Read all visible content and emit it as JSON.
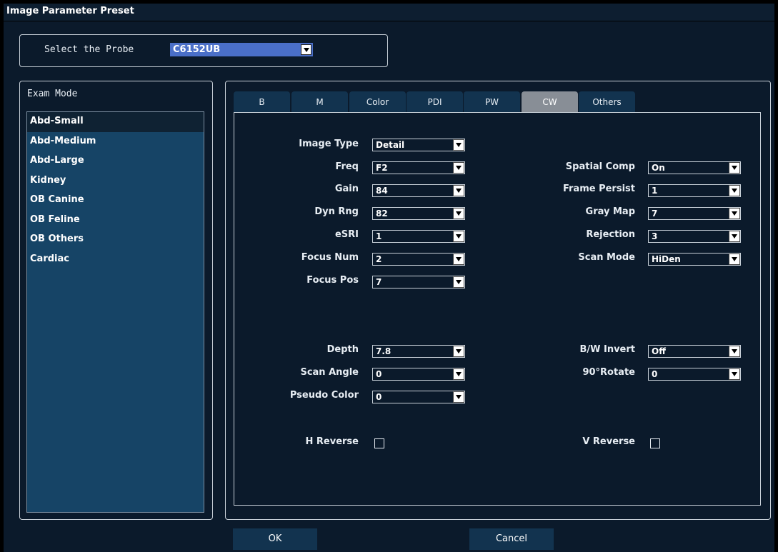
{
  "window": {
    "title": "Image Parameter Preset"
  },
  "probe": {
    "label": "Select the Probe",
    "value": "C6152UB"
  },
  "exam": {
    "title": "Exam Mode",
    "items": [
      "Abd-Small",
      "Abd-Medium",
      "Abd-Large",
      "Kidney",
      "OB Canine",
      "OB Feline",
      "OB Others",
      "Cardiac"
    ],
    "selected": "Abd-Small"
  },
  "tabs": [
    "B",
    "M",
    "Color",
    "PDI",
    "PW",
    "CW",
    "Others"
  ],
  "active_tab": "CW",
  "left_params": [
    {
      "label": "Image Type",
      "value": "Detail"
    },
    {
      "label": "Freq",
      "value": "F2"
    },
    {
      "label": "Gain",
      "value": "84"
    },
    {
      "label": "Dyn Rng",
      "value": "82"
    },
    {
      "label": "eSRI",
      "value": "1"
    },
    {
      "label": "Focus Num",
      "value": "2"
    },
    {
      "label": "Focus Pos",
      "value": "7"
    }
  ],
  "right_params": [
    {
      "label": "Spatial Comp",
      "value": "On"
    },
    {
      "label": "Frame Persist",
      "value": "1"
    },
    {
      "label": "Gray Map",
      "value": "7"
    },
    {
      "label": "Rejection",
      "value": "3"
    },
    {
      "label": "Scan Mode",
      "value": "HiDen"
    }
  ],
  "left_params2": [
    {
      "label": "Depth",
      "value": "7.8"
    },
    {
      "label": "Scan Angle",
      "value": "0"
    },
    {
      "label": "Pseudo Color",
      "value": "0"
    }
  ],
  "right_params2": [
    {
      "label": "B/W Invert",
      "value": "Off"
    },
    {
      "label": "90°Rotate",
      "value": "0"
    }
  ],
  "checks": {
    "h_reverse": "H Reverse",
    "v_reverse": "V Reverse"
  },
  "buttons": {
    "ok": "OK",
    "cancel": "Cancel"
  }
}
